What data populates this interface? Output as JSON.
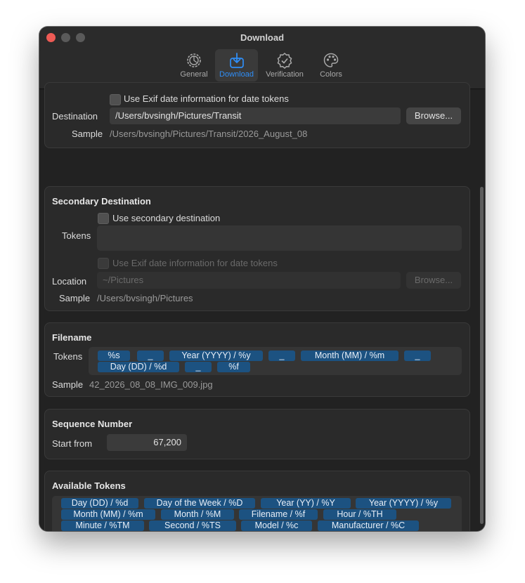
{
  "window": {
    "title": "Download"
  },
  "tabs": [
    {
      "label": "General",
      "icon": "gear-icon"
    },
    {
      "label": "Download",
      "icon": "download-icon"
    },
    {
      "label": "Verification",
      "icon": "verification-badge-icon"
    },
    {
      "label": "Colors",
      "icon": "palette-icon"
    }
  ],
  "primary": {
    "exif_label": "Use Exif date information for date tokens",
    "destination_label": "Destination",
    "destination_value": "/Users/bvsingh/Pictures/Transit",
    "browse_label": "Browse...",
    "sample_label": "Sample",
    "sample_value": "/Users/bvsingh/Pictures/Transit/2026_August_08"
  },
  "secondary": {
    "title": "Secondary Destination",
    "use_label": "Use secondary destination",
    "tokens_label": "Tokens",
    "exif_label": "Use Exif date information for date tokens",
    "location_label": "Location",
    "location_placeholder": "~/Pictures",
    "browse_label": "Browse...",
    "sample_label": "Sample",
    "sample_value": "/Users/bvsingh/Pictures"
  },
  "filename": {
    "title": "Filename",
    "tokens_label": "Tokens",
    "tokens": [
      "%s",
      "_",
      "Year (YYYY) / %y",
      "_",
      "Month (MM) / %m",
      "_",
      "Day (DD) / %d",
      "_",
      "%f"
    ],
    "sample_label": "Sample",
    "sample_value": "42_2026_08_08_IMG_009.jpg"
  },
  "sequence": {
    "title": "Sequence Number",
    "start_label": "Start from",
    "start_value": "67,200"
  },
  "available": {
    "title": "Available Tokens",
    "tokens": [
      "Day (DD) / %d",
      "Day of the Week / %D",
      "Year (YY) / %Y",
      "Year (YYYY) / %y",
      "Month (MM) / %m",
      "Month / %M",
      "Filename / %f",
      "Hour / %TH",
      "Minute / %TM",
      "Second / %TS",
      "Model / %c",
      "Manufacturer / %C"
    ]
  },
  "colors": {
    "accent": "#2f8ef7",
    "token_bg": "#1c5281",
    "close_button": "#ee5b55"
  }
}
